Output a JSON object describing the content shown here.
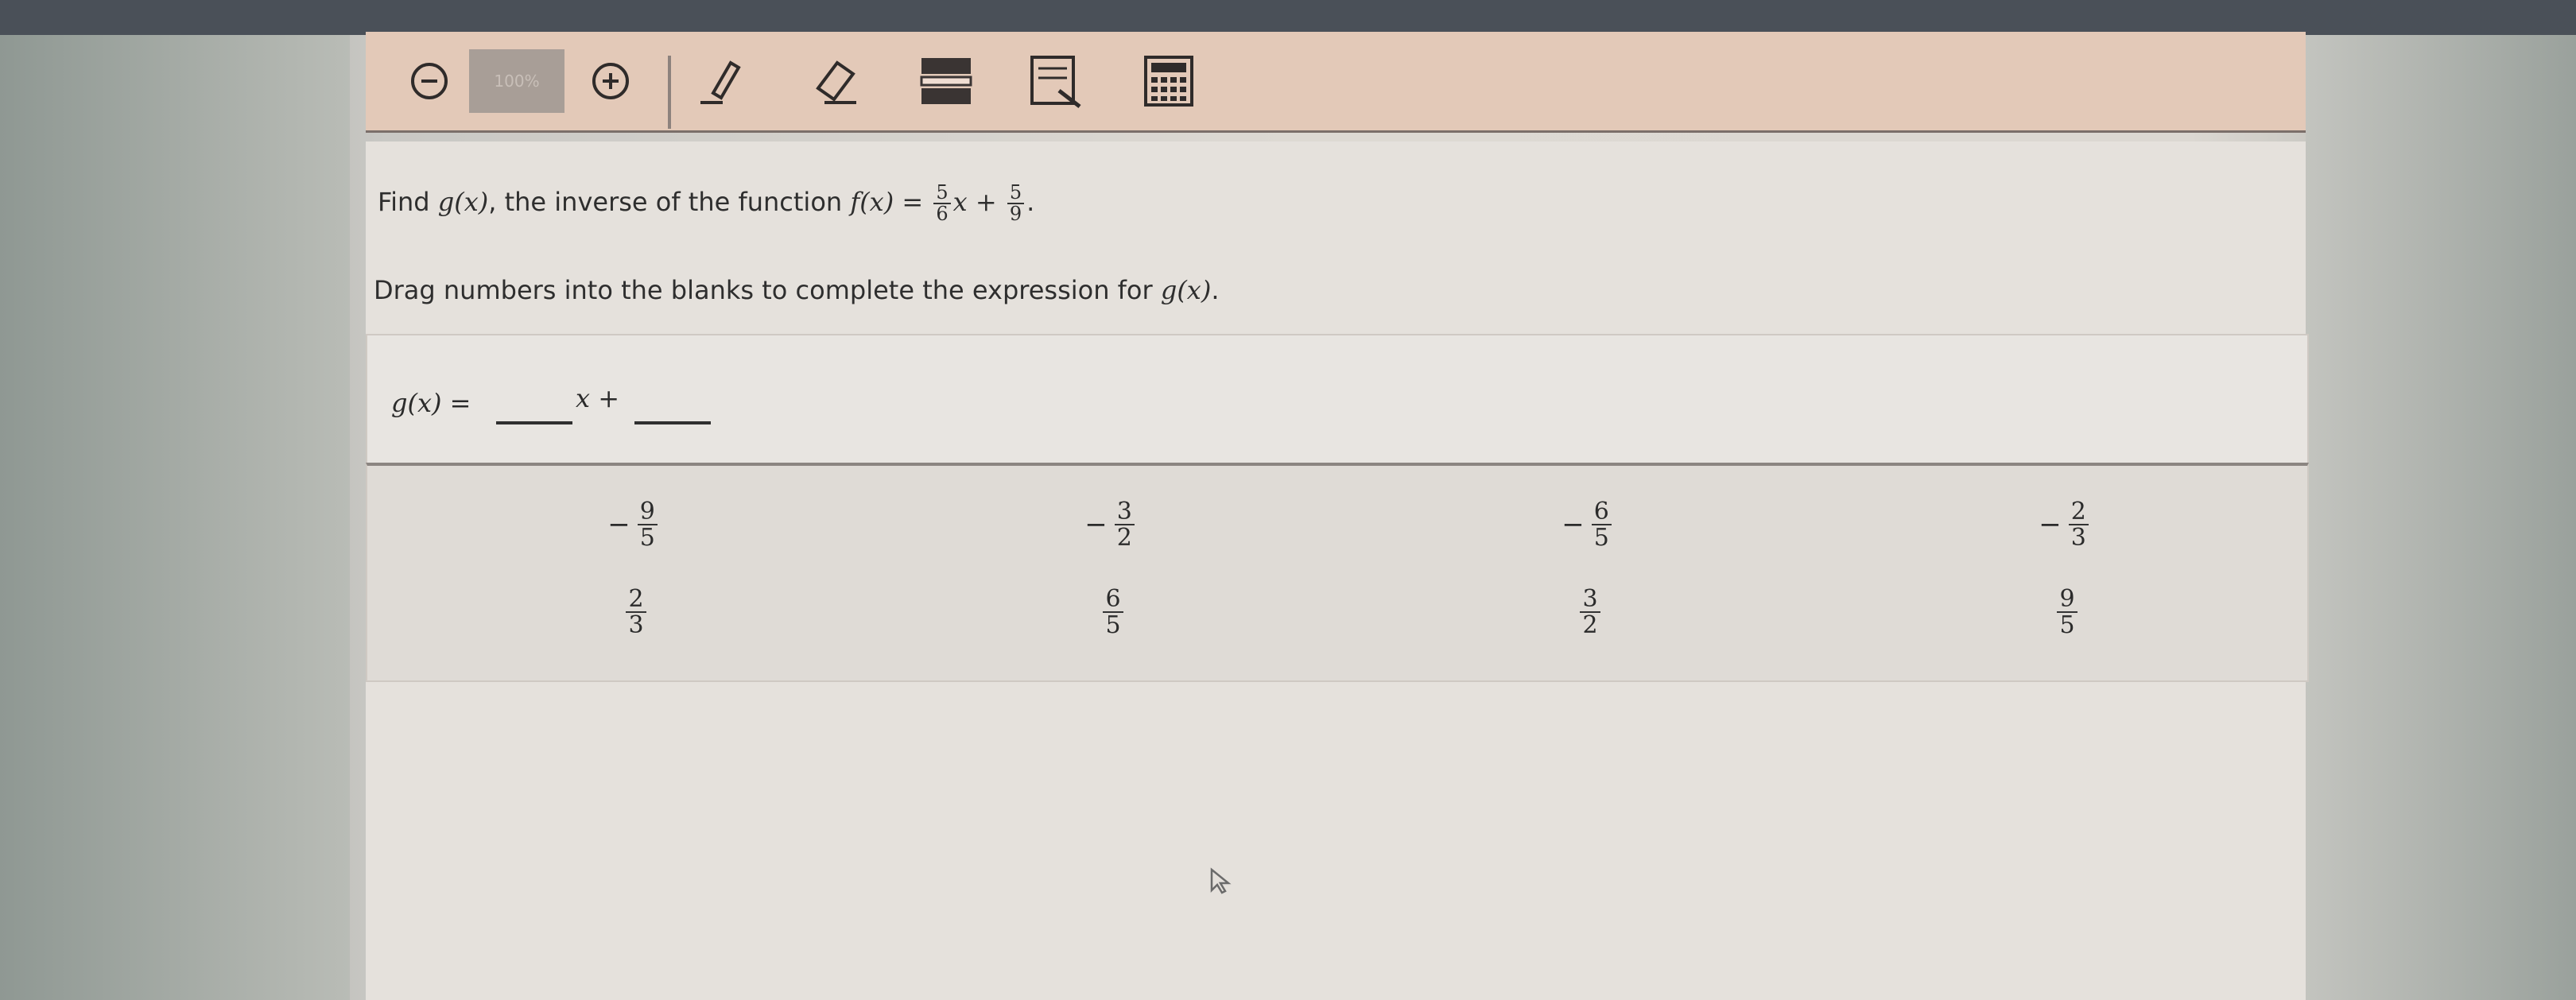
{
  "toolbar": {
    "zoom_level": "100%",
    "tools": [
      "zoom-out-icon",
      "zoom-in-icon",
      "highlighter-icon",
      "eraser-icon",
      "line-reader-icon",
      "notepad-icon",
      "calculator-icon"
    ]
  },
  "question": {
    "prompt_prefix": "Find",
    "gx": "g(x)",
    "prompt_mid": ", the inverse of the function",
    "fx": "f(x) =",
    "coef_num": "5",
    "coef_den": "6",
    "x_plus": "x +",
    "const_num": "5",
    "const_den": "9",
    "period": ".",
    "instruction_text": "Drag numbers into the blanks to complete the expression for",
    "instruction_gx": "g(x)",
    "instruction_period": "."
  },
  "answer": {
    "lhs": "g(x) =",
    "x_plus": "x +"
  },
  "options": [
    {
      "sign": "−",
      "num": "9",
      "den": "5"
    },
    {
      "sign": "−",
      "num": "3",
      "den": "2"
    },
    {
      "sign": "−",
      "num": "6",
      "den": "5"
    },
    {
      "sign": "−",
      "num": "2",
      "den": "3"
    },
    {
      "sign": "",
      "num": "2",
      "den": "3"
    },
    {
      "sign": "",
      "num": "6",
      "den": "5"
    },
    {
      "sign": "",
      "num": "3",
      "den": "2"
    },
    {
      "sign": "",
      "num": "9",
      "den": "5"
    }
  ],
  "colors": {
    "toolbar_bg": "#e3c9b8",
    "content_bg": "#e5e1dc",
    "screen_frame": "#4a5058"
  }
}
